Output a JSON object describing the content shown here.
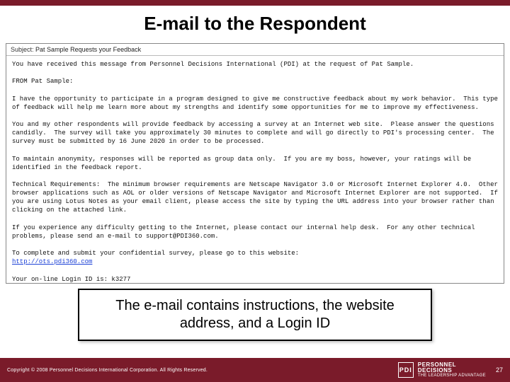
{
  "title": "E-mail to the Respondent",
  "subject": {
    "label": "Subject:",
    "value": "Pat Sample Requests your Feedback"
  },
  "email": {
    "p1": "You have received this message from Personnel Decisions International (PDI) at the request of Pat Sample.",
    "p2": "FROM Pat Sample:",
    "p3": "I have the opportunity to participate in a program designed to give me constructive feedback about my work behavior.  This type of feedback will help me learn more about my strengths and identify some opportunities for me to improve my effectiveness.",
    "p4": "You and my other respondents will provide feedback by accessing a survey at an Internet web site.  Please answer the questions candidly.  The survey will take you approximately 30 minutes to complete and will go directly to PDI's processing center.  The survey must be submitted by 16 June 2020 in order to be processed.",
    "p5": "To maintain anonymity, responses will be reported as group data only.  If you are my boss, however, your ratings will be identified in the feedback report.",
    "p6": "Technical Requirements:  The minimum browser requirements are Netscape Navigator 3.0 or Microsoft Internet Explorer 4.0.  Other browser applications such as AOL or older versions of Netscape Navigator and Microsoft Internet Explorer are not supported.  If you are using Lotus Notes as your email client, please access the site by typing the URL address into your browser rather than clicking on the attached link.",
    "p7": "If you experience any difficulty getting to the Internet, please contact our internal help desk.  For any other technical problems, please send an e-mail to support@PDI360.com.",
    "p8": "To complete and submit your confidential survey, please go to this website:",
    "url": "http://ots.pdi360.com",
    "p9": "Your on-line Login ID is: k3277"
  },
  "callout": "The e-mail contains instructions, the website address, and a Login ID",
  "footer": {
    "copyright": "Copyright © 2008 Personnel Decisions International Corporation. All Rights Reserved.",
    "logo_abbr": "PDI",
    "logo1": "PERSONNEL",
    "logo2": "DECISIONS",
    "logo_tag": "THE LEADERSHIP ADVANTAGE",
    "page": "27"
  }
}
